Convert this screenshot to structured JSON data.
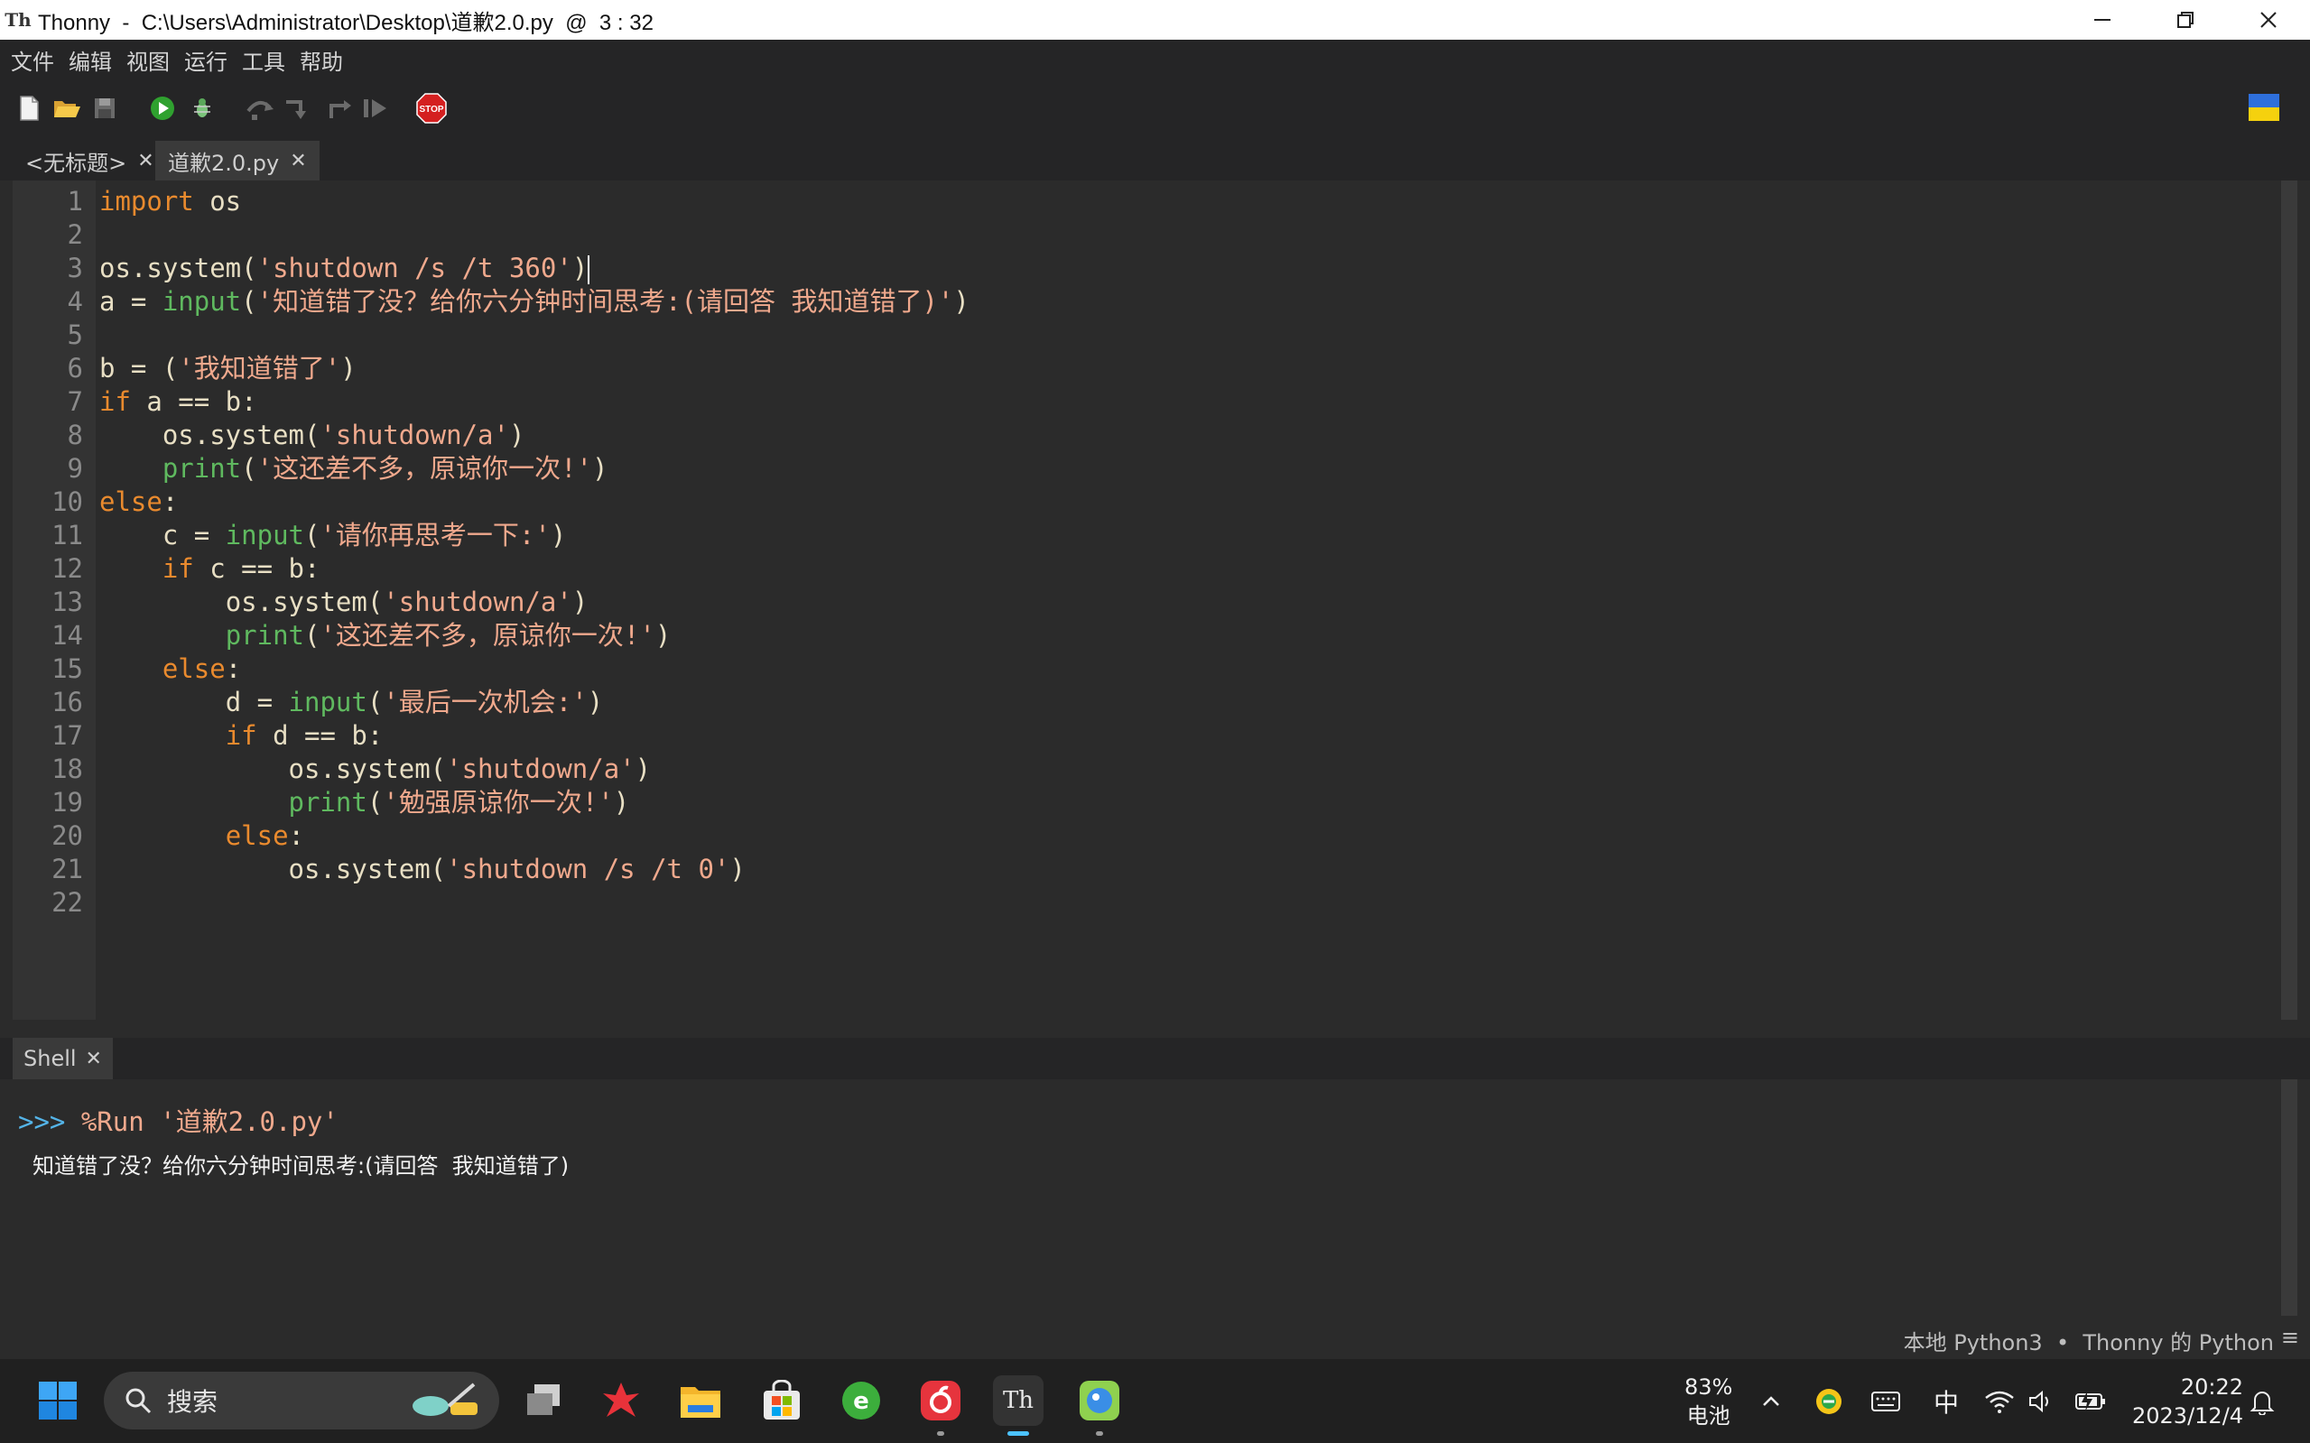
{
  "window": {
    "title": "Thonny  -  C:\\Users\\Administrator\\Desktop\\道歉2.0.py  @  3 : 32",
    "app_icon_label": "Th"
  },
  "menubar": {
    "items": [
      "文件",
      "编辑",
      "视图",
      "运行",
      "工具",
      "帮助"
    ]
  },
  "toolbar": {
    "buttons": [
      "new-file",
      "open-file",
      "save-file",
      "run",
      "debug",
      "step-over",
      "step-into",
      "step-out",
      "resume",
      "stop"
    ],
    "stop_label": "STOP",
    "flag": {
      "top": "#2e6fdc",
      "bottom": "#f5d10e"
    }
  },
  "editor_tabs": [
    {
      "label": "<无标题>",
      "close": "✕",
      "active": false
    },
    {
      "label": "道歉2.0.py",
      "close": "✕",
      "active": true
    }
  ],
  "editor": {
    "line_numbers": [
      "1",
      "2",
      "3",
      "4",
      "5",
      "6",
      "7",
      "8",
      "9",
      "10",
      "11",
      "12",
      "13",
      "14",
      "15",
      "16",
      "17",
      "18",
      "19",
      "20",
      "21",
      "22"
    ],
    "code": {
      "l1": {
        "kw": "import",
        "rest": " os"
      },
      "l3": {
        "a": "os.system(",
        "s": "'shutdown /s /t 360'",
        "b": ")"
      },
      "l4": {
        "a": "a = ",
        "bi": "input",
        "b": "(",
        "s": "'知道错了没？给你六分钟时间思考:(请回答 我知道错了)'",
        "c": ")"
      },
      "l6": {
        "a": "b = (",
        "s": "'我知道错了'",
        "b": ")"
      },
      "l7": {
        "kw": "if",
        "rest": " a == b:"
      },
      "l8": {
        "indent": "    ",
        "a": "os.system(",
        "s": "'shutdown/a'",
        "b": ")"
      },
      "l9": {
        "indent": "    ",
        "bi": "print",
        "a": "(",
        "s": "'这还差不多，原谅你一次!'",
        "b": ")"
      },
      "l10": {
        "kw": "else",
        "rest": ":"
      },
      "l11": {
        "indent": "    ",
        "a": "c = ",
        "bi": "input",
        "b": "(",
        "s": "'请你再思考一下:'",
        "c": ")"
      },
      "l12": {
        "indent": "    ",
        "kw": "if",
        "rest": " c == b:"
      },
      "l13": {
        "indent": "        ",
        "a": "os.system(",
        "s": "'shutdown/a'",
        "b": ")"
      },
      "l14": {
        "indent": "        ",
        "bi": "print",
        "a": "(",
        "s": "'这还差不多，原谅你一次!'",
        "b": ")"
      },
      "l15": {
        "indent": "    ",
        "kw": "else",
        "rest": ":"
      },
      "l16": {
        "indent": "        ",
        "a": "d = ",
        "bi": "input",
        "b": "(",
        "s": "'最后一次机会:'",
        "c": ")"
      },
      "l17": {
        "indent": "        ",
        "kw": "if",
        "rest": " d == b:"
      },
      "l18": {
        "indent": "            ",
        "a": "os.system(",
        "s": "'shutdown/a'",
        "b": ")"
      },
      "l19": {
        "indent": "            ",
        "bi": "print",
        "a": "(",
        "s": "'勉强原谅你一次!'",
        "b": ")"
      },
      "l20": {
        "indent": "        ",
        "kw": "else",
        "rest": ":"
      },
      "l21": {
        "indent": "            ",
        "a": "os.system(",
        "s": "'shutdown /s /t 0'",
        "b": ")"
      }
    }
  },
  "shell": {
    "tab_label": "Shell",
    "tab_close": "✕",
    "prompt": ">>>",
    "command": " %Run '道歉2.0.py'",
    "output": "知道错了没？给你六分钟时间思考:(请回答  我知道错了)"
  },
  "statusbar": {
    "interpreter": "本地 Python3  •  Thonny 的 Python",
    "menu": "≡"
  },
  "taskbar": {
    "search_placeholder": "搜索",
    "apps": [
      "task-view",
      "wps",
      "file-explorer",
      "microsoft-store",
      "browser",
      "netease-music",
      "thonny",
      "bird-app"
    ],
    "thonny_label": "Th",
    "battery": "83%",
    "battery_label": "电池",
    "ime": "中",
    "time": "20:22",
    "date": "2023/12/4"
  }
}
